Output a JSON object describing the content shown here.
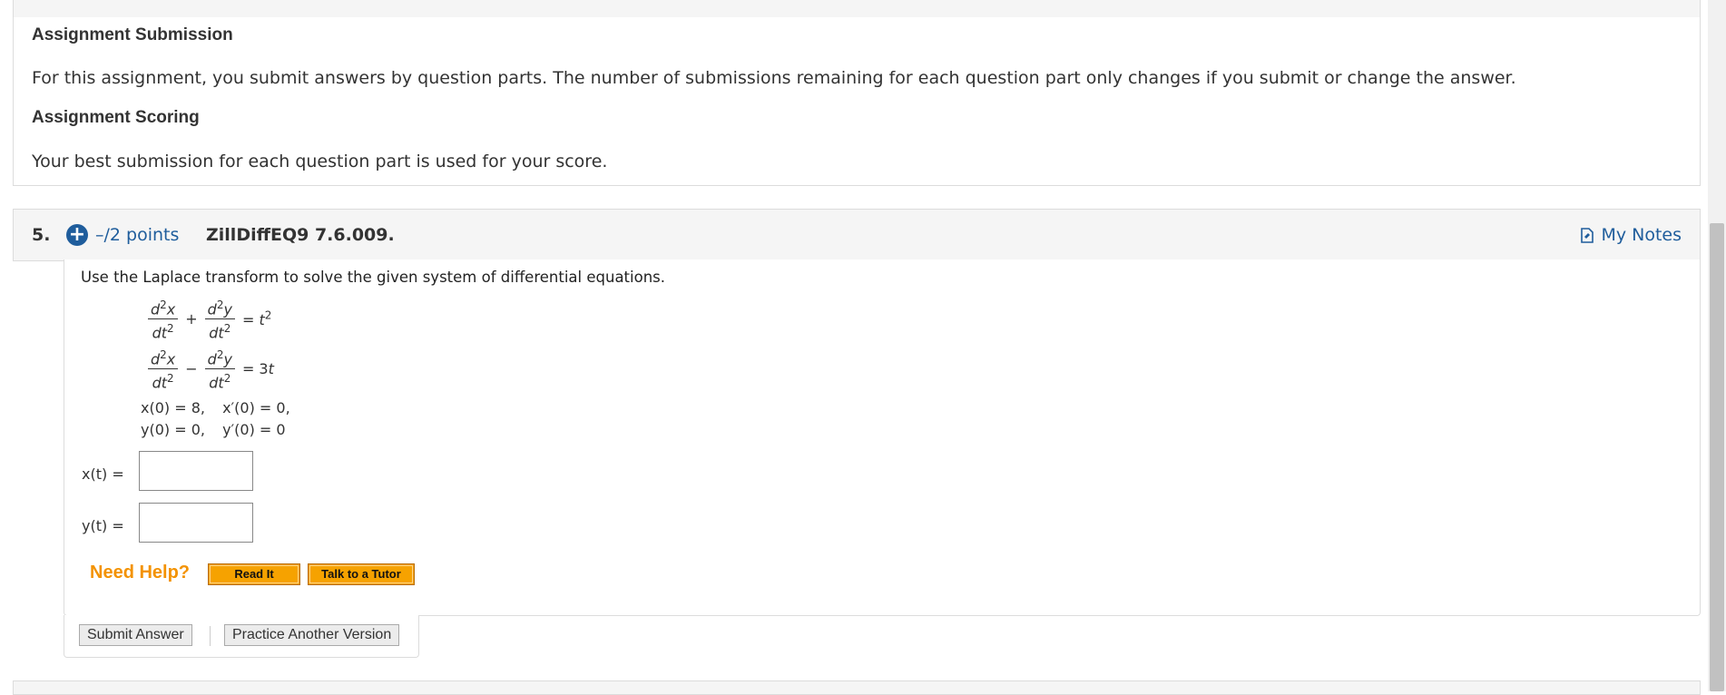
{
  "info": {
    "submission_heading": "Assignment Submission",
    "submission_text": "For this assignment, you submit answers by question parts. The number of submissions remaining for each question part only changes if you submit or change the answer.",
    "scoring_heading": "Assignment Scoring",
    "scoring_text": "Your best submission for each question part is used for your score."
  },
  "question": {
    "number": "5.",
    "points": "–/2 points",
    "code": "ZillDiffEQ9 7.6.009.",
    "my_notes": "My Notes",
    "prompt": "Use the Laplace transform to solve the given system of differential equations.",
    "initial_conditions": {
      "row1_a": "x(0) = 8,",
      "row1_b": "x′(0) = 0,",
      "row2_a": "y(0) = 0,",
      "row2_b": "y′(0) = 0"
    },
    "answers": [
      {
        "label": "x(t) =",
        "value": ""
      },
      {
        "label": "y(t) =",
        "value": ""
      }
    ]
  },
  "help": {
    "need_help": "Need Help?",
    "read_it": "Read It",
    "talk_to_tutor": "Talk to a Tutor"
  },
  "actions": {
    "submit": "Submit Answer",
    "practice": "Practice Another Version"
  },
  "colors": {
    "link_blue": "#1f5d9c",
    "help_orange": "#f39200",
    "help_button": "#f6a200"
  }
}
